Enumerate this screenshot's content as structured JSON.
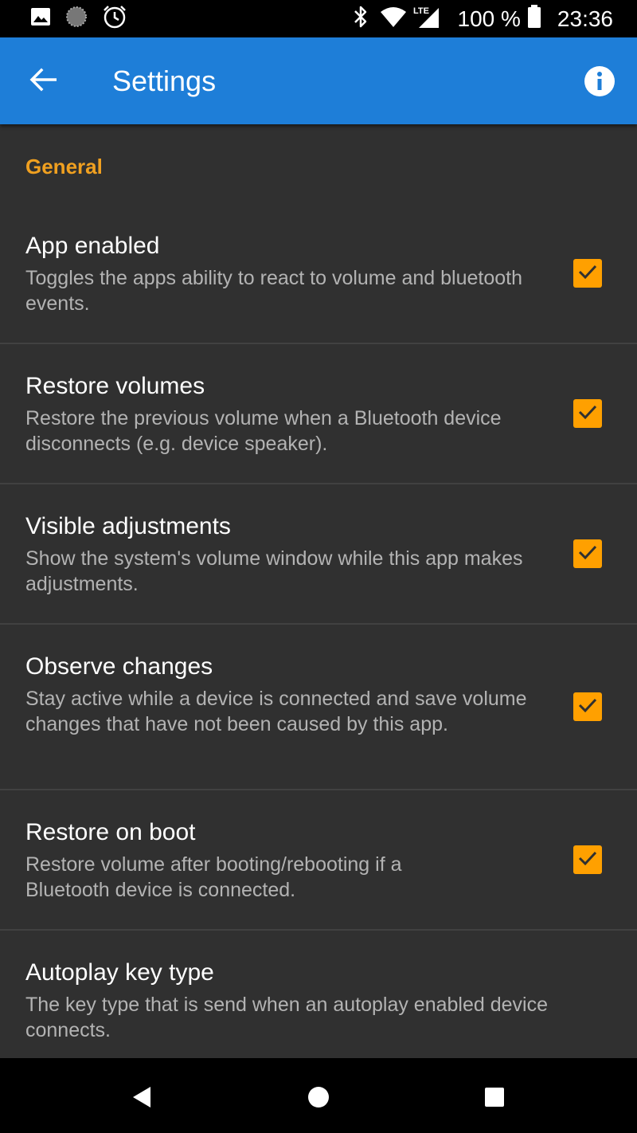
{
  "status_bar": {
    "battery_pct": "100 %",
    "time": "23:36",
    "network": "LTE",
    "icons": [
      "image-icon",
      "loading-icon",
      "alarm-icon",
      "bluetooth-icon",
      "wifi-icon",
      "signal-icon",
      "battery-icon"
    ]
  },
  "app_bar": {
    "title": "Settings",
    "back_icon": "arrow-back-icon",
    "info_icon": "info-icon",
    "color": "#1e7ed8"
  },
  "section": {
    "title": "General",
    "color": "#f0a020"
  },
  "preferences": [
    {
      "title": "App enabled",
      "summary": "Toggles the apps ability to react to volume and bluetooth events.",
      "checked": true
    },
    {
      "title": "Restore volumes",
      "summary": "Restore the previous volume when a Bluetooth device disconnects (e.g. device speaker).",
      "checked": true
    },
    {
      "title": "Visible adjustments",
      "summary": "Show the system's volume window while this app makes adjustments.",
      "checked": true
    },
    {
      "title": "Observe changes",
      "summary": "Stay active while a device is connected and save volume changes that have not been caused by this app.",
      "checked": true
    },
    {
      "title": "Restore on boot",
      "summary": "Restore volume after booting/rebooting if a Bluetooth device is connected.",
      "checked": true
    },
    {
      "title": "Autoplay key type",
      "summary": "The key type that is send when an autoplay enabled device connects."
    }
  ],
  "checkbox_color": "#ffa000",
  "nav_bar": {
    "icons": [
      "nav-back-icon",
      "nav-home-icon",
      "nav-recents-icon"
    ]
  }
}
